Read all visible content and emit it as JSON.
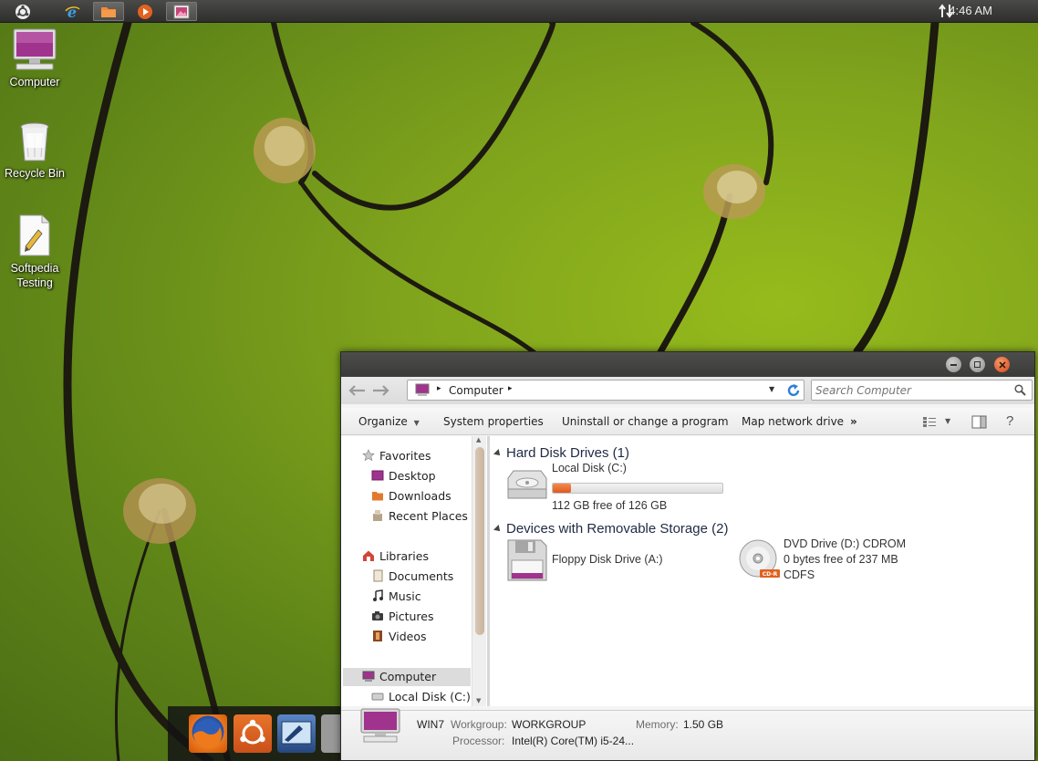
{
  "panel": {
    "clock": "4:46 AM",
    "apps": [
      "ubuntu-menu",
      "internet-explorer",
      "file-manager",
      "media-player",
      "photo-viewer"
    ]
  },
  "desktop": {
    "icons": [
      {
        "label": "Computer"
      },
      {
        "label": "Recycle Bin"
      },
      {
        "label": "Softpedia Testing"
      }
    ]
  },
  "dock": {
    "items": [
      "firefox",
      "ubuntu",
      "display-settings",
      "recycle",
      "computer"
    ]
  },
  "explorer": {
    "breadcrumb": "Computer",
    "search": {
      "placeholder": "Search Computer"
    },
    "toolbar": {
      "organize": "Organize",
      "system_properties": "System properties",
      "uninstall": "Uninstall or change a program",
      "map_drive": "Map network drive",
      "more": "»"
    },
    "nav": {
      "favorites": "Favorites",
      "desktop": "Desktop",
      "downloads": "Downloads",
      "recent": "Recent Places",
      "libraries": "Libraries",
      "documents": "Documents",
      "music": "Music",
      "pictures": "Pictures",
      "videos": "Videos",
      "computer": "Computer",
      "local_disk": "Local Disk (C:)"
    },
    "groups": {
      "hard_disks": "Hard Disk Drives (1)",
      "removable": "Devices with Removable Storage (2)"
    },
    "drives": {
      "c_name": "Local Disk (C:)",
      "c_free": "112 GB free of 126 GB",
      "c_used_fraction": 0.11,
      "a_name": "Floppy Disk Drive (A:)",
      "d_name": "DVD Drive (D:) CDROM",
      "d_free": "0 bytes free of 237 MB",
      "d_fs": "CDFS"
    },
    "details": {
      "name": "WIN7",
      "workgroup_label": "Workgroup:",
      "workgroup": "WORKGROUP",
      "memory_label": "Memory:",
      "memory": "1.50 GB",
      "processor_label": "Processor:",
      "processor": "Intel(R) Core(TM) i5-24..."
    }
  },
  "colors": {
    "accent_orange": "#e0621f",
    "wallpaper_green": "#7fa31c",
    "panel_dark": "#3a3a38"
  }
}
